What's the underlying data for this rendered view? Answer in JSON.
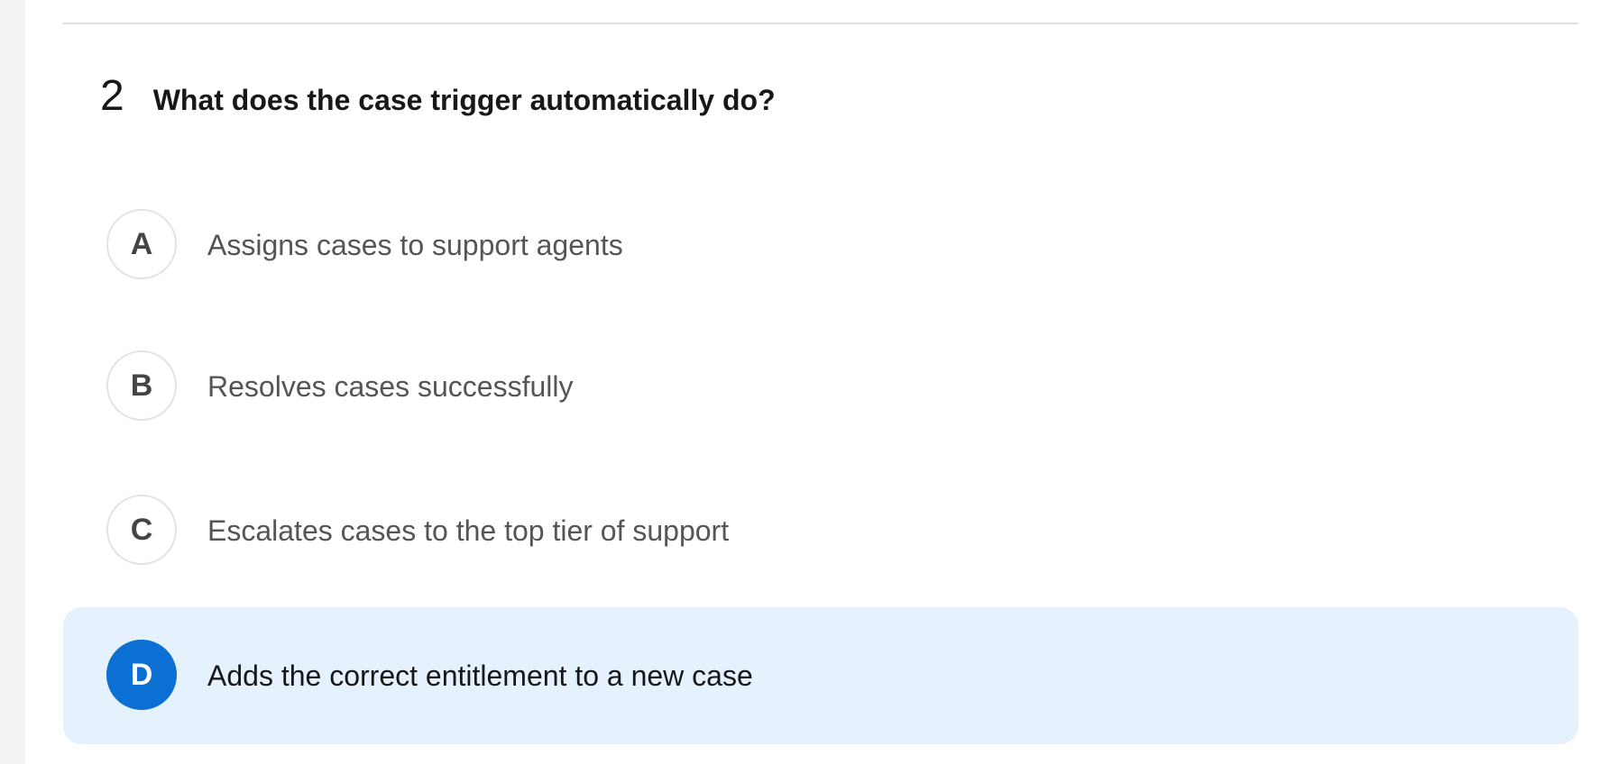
{
  "question": {
    "number": "2",
    "text": "What does the case trigger automatically do?"
  },
  "options": [
    {
      "letter": "A",
      "text": "Assigns cases to support agents",
      "selected": false
    },
    {
      "letter": "B",
      "text": "Resolves cases successfully",
      "selected": false
    },
    {
      "letter": "C",
      "text": "Escalates cases to the top tier of support",
      "selected": false
    },
    {
      "letter": "D",
      "text": "Adds the correct entitlement to a new case",
      "selected": true
    }
  ],
  "colors": {
    "selected_background": "#e5f1fd",
    "selected_badge": "#0b6fd3",
    "text_primary": "#181818",
    "text_secondary": "#555555"
  }
}
